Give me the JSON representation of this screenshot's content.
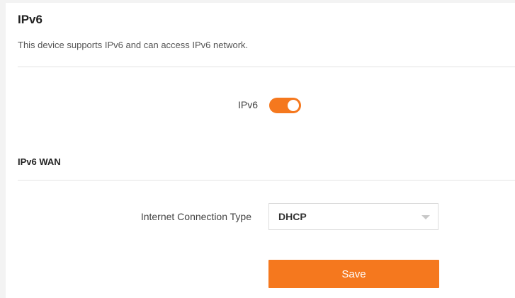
{
  "page": {
    "title": "IPv6",
    "description": "This device supports IPv6 and can access IPv6 network."
  },
  "ipv6_toggle": {
    "label": "IPv6",
    "state": "on",
    "accent_color": "#f5781e"
  },
  "ipv6_wan": {
    "section_title": "IPv6 WAN",
    "connection_type_label": "Internet Connection Type",
    "connection_type_value": "DHCP"
  },
  "actions": {
    "save_label": "Save"
  }
}
